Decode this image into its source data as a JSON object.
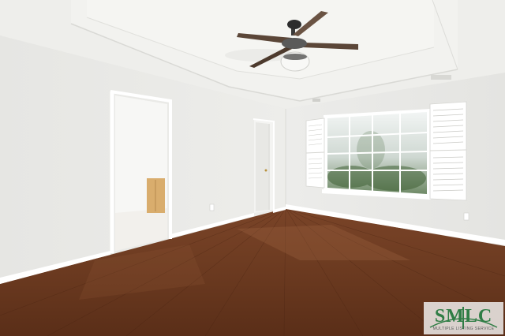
{
  "photo": {
    "subject": "empty-bedroom-interior"
  },
  "watermark": {
    "text": "SMLC",
    "subtext": "MULTIPLE LISTING SERVICE",
    "brand_color": "#2f7d45"
  },
  "palette": {
    "wall": "#ecece9",
    "ceiling": "#efefec",
    "floor_dark": "#5a2e18",
    "floor_light": "#8a5433",
    "trim": "#ffffff",
    "fan_blade": "#5b4638"
  }
}
